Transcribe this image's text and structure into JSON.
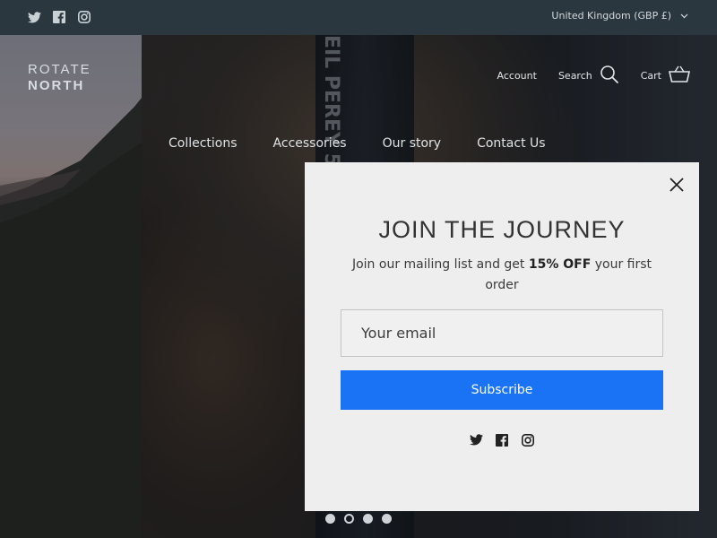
{
  "topbar": {
    "social_icons": [
      "twitter-icon",
      "facebook-icon",
      "instagram-icon"
    ],
    "region": "United Kingdom (GBP £)"
  },
  "hero": {
    "band_text": "EIL  PEREY 5"
  },
  "header": {
    "logo_line1": "ROTATE",
    "logo_line2": "NORTH",
    "account": "Account",
    "search": "Search",
    "cart": "Cart"
  },
  "nav": {
    "items": [
      {
        "label": "Collections"
      },
      {
        "label": "Accessories"
      },
      {
        "label": "Our story"
      },
      {
        "label": "Contact Us"
      }
    ]
  },
  "modal": {
    "title": "JOIN THE JOURNEY",
    "text_before": "Join our mailing list and get ",
    "text_bold": "15% OFF",
    "text_after": " your first order",
    "email_placeholder": "Your email",
    "subscribe_label": "Subscribe",
    "social_icons": [
      "twitter-icon",
      "facebook-icon",
      "instagram-icon"
    ]
  },
  "slider": {
    "count": 4,
    "active_index": 1
  },
  "colors": {
    "topbar": "#2b373e",
    "accent": "#1a73f5",
    "modal_bg": "#eeeeee"
  }
}
